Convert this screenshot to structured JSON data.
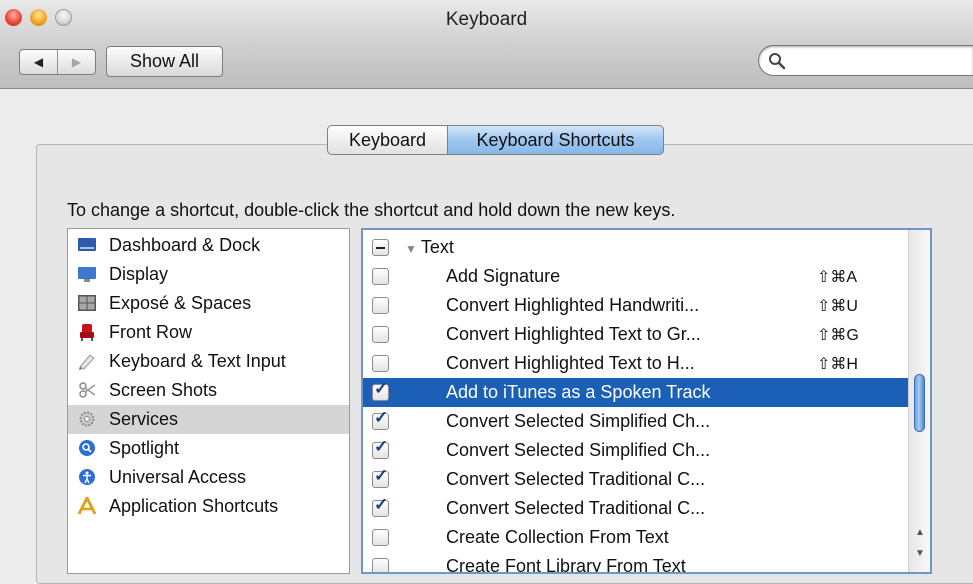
{
  "window": {
    "title": "Keyboard"
  },
  "toolbar": {
    "back_label": "◀",
    "forward_label": "▶",
    "show_all_label": "Show All",
    "search_placeholder": ""
  },
  "tabs": [
    {
      "label": "Keyboard",
      "selected": false
    },
    {
      "label": "Keyboard Shortcuts",
      "selected": true
    }
  ],
  "instructions": "To change a shortcut, double-click the shortcut and hold down the new keys.",
  "sidebar": {
    "items": [
      {
        "label": "Dashboard & Dock",
        "icon": "dashboard-dock-icon",
        "selected": false
      },
      {
        "label": "Display",
        "icon": "display-icon",
        "selected": false
      },
      {
        "label": "Exposé & Spaces",
        "icon": "expose-spaces-icon",
        "selected": false
      },
      {
        "label": "Front Row",
        "icon": "front-row-icon",
        "selected": false
      },
      {
        "label": "Keyboard & Text Input",
        "icon": "keyboard-text-input-icon",
        "selected": false
      },
      {
        "label": "Screen Shots",
        "icon": "screen-shots-icon",
        "selected": false
      },
      {
        "label": "Services",
        "icon": "services-gear-icon",
        "selected": true
      },
      {
        "label": "Spotlight",
        "icon": "spotlight-icon",
        "selected": false
      },
      {
        "label": "Universal Access",
        "icon": "universal-access-icon",
        "selected": false
      },
      {
        "label": "Application Shortcuts",
        "icon": "application-shortcuts-icon",
        "selected": false
      }
    ]
  },
  "shortcuts": {
    "group": {
      "label": "Text",
      "state": "mixed",
      "expanded": true
    },
    "rows": [
      {
        "label": "Add Signature",
        "keys": "⇧⌘A",
        "checked": false,
        "selected": false
      },
      {
        "label": "Convert Highlighted Handwriti...",
        "keys": "⇧⌘U",
        "checked": false,
        "selected": false
      },
      {
        "label": "Convert Highlighted Text to Gr...",
        "keys": "⇧⌘G",
        "checked": false,
        "selected": false
      },
      {
        "label": "Convert Highlighted Text to H...",
        "keys": "⇧⌘H",
        "checked": false,
        "selected": false
      },
      {
        "label": "Add to iTunes as a Spoken Track",
        "keys": "",
        "checked": true,
        "selected": true
      },
      {
        "label": "Convert Selected Simplified Ch...",
        "keys": "",
        "checked": true,
        "selected": false
      },
      {
        "label": "Convert Selected Simplified Ch...",
        "keys": "",
        "checked": true,
        "selected": false
      },
      {
        "label": "Convert Selected Traditional C...",
        "keys": "",
        "checked": true,
        "selected": false
      },
      {
        "label": "Convert Selected Traditional C...",
        "keys": "",
        "checked": true,
        "selected": false
      },
      {
        "label": "Create Collection From Text",
        "keys": "",
        "checked": false,
        "selected": false
      },
      {
        "label": "Create Font Library From Text",
        "keys": "",
        "checked": false,
        "selected": false
      }
    ]
  },
  "colors": {
    "selection": "#1b5fb7",
    "tab_selected": "#9ec7ef",
    "sidebar_selected": "#d5d5d5"
  }
}
